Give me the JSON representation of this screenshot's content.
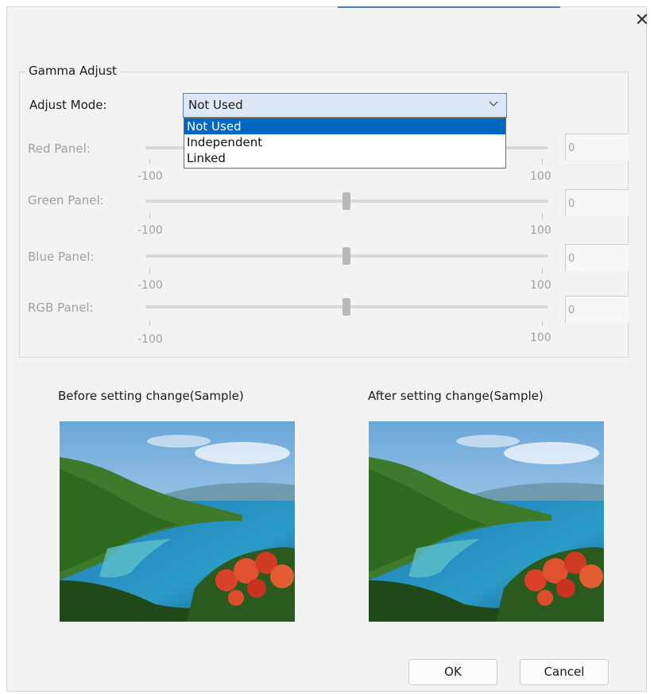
{
  "window": {
    "close_glyph": "✕"
  },
  "gamma": {
    "group_title": "Gamma Adjust",
    "adjust_mode_label": "Adjust Mode:",
    "adjust_mode_value": "Not Used",
    "options": [
      "Not Used",
      "Independent",
      "Linked"
    ],
    "selected_option_index": 0,
    "sliders": [
      {
        "label": "Red Panel:",
        "min_label": "-100",
        "max_label": "100",
        "value": "0"
      },
      {
        "label": "Green Panel:",
        "min_label": "-100",
        "max_label": "100",
        "value": "0"
      },
      {
        "label": "Blue Panel:",
        "min_label": "-100",
        "max_label": "100",
        "value": "0"
      },
      {
        "label": "RGB Panel:",
        "min_label": "-100",
        "max_label": "100",
        "value": "0"
      }
    ]
  },
  "samples": {
    "before_label": "Before setting change(Sample)",
    "after_label": "After setting change(Sample)"
  },
  "buttons": {
    "ok": "OK",
    "cancel": "Cancel"
  },
  "colors": {
    "accent": "#0067c0",
    "combo_bg": "#dde8f6",
    "dim_text": "#a0a0a0"
  },
  "icons": {
    "close": "close-icon",
    "dropdown": "chevron-down-icon"
  }
}
